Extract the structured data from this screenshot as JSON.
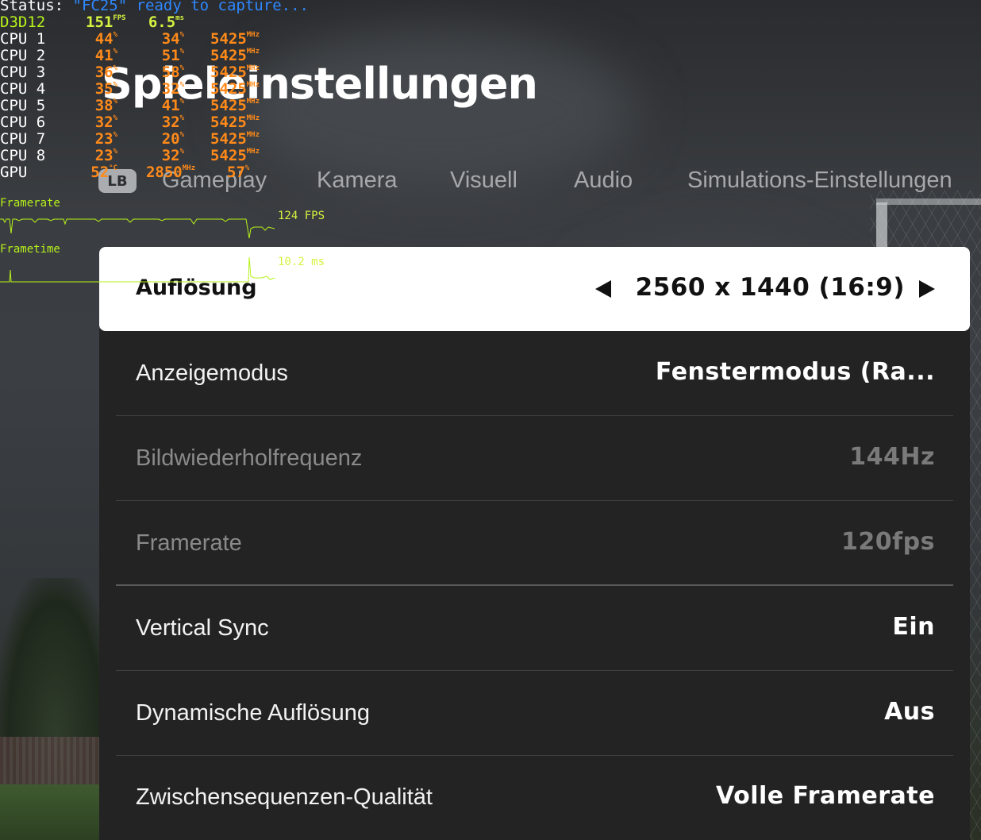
{
  "page": {
    "title": "Spieleinstellungen"
  },
  "tabs": {
    "lb_badge": "LB",
    "items": [
      "Gameplay",
      "Kamera",
      "Visuell",
      "Audio",
      "Simulations-Einstellungen"
    ]
  },
  "settings": [
    {
      "label": "Auflösung",
      "value": "2560 x 1440 (16:9)",
      "state": "selected"
    },
    {
      "label": "Anzeigemodus",
      "value": "Fenstermodus (Ra...",
      "state": "normal"
    },
    {
      "label": "Bildwiederholfrequenz",
      "value": "144Hz",
      "state": "disabled"
    },
    {
      "label": "Framerate",
      "value": "120fps",
      "state": "disabled"
    },
    {
      "label": "Vertical Sync",
      "value": "Ein",
      "state": "normal"
    },
    {
      "label": "Dynamische Auflösung",
      "value": "Aus",
      "state": "normal"
    },
    {
      "label": "Zwischensequenzen-Qualität",
      "value": "Volle Framerate",
      "state": "normal"
    }
  ],
  "osd": {
    "status_key": "Status:",
    "status_value": "\"FC25\" ready to capture...",
    "api": {
      "name": "D3D12",
      "fps": "151",
      "fps_unit": "FPS",
      "frametime": "6.5",
      "frametime_unit": "ms"
    },
    "cpus": [
      {
        "name": "CPU 1",
        "load": "44",
        "temp": "34",
        "clock": "5425"
      },
      {
        "name": "CPU 2",
        "load": "41",
        "temp": "51",
        "clock": "5425"
      },
      {
        "name": "CPU 3",
        "load": "36",
        "temp": "58",
        "clock": "5425"
      },
      {
        "name": "CPU 4",
        "load": "35",
        "temp": "32",
        "clock": "5425"
      },
      {
        "name": "CPU 5",
        "load": "38",
        "temp": "41",
        "clock": "5425"
      },
      {
        "name": "CPU 6",
        "load": "32",
        "temp": "32",
        "clock": "5425"
      },
      {
        "name": "CPU 7",
        "load": "23",
        "temp": "20",
        "clock": "5425"
      },
      {
        "name": "CPU 8",
        "load": "23",
        "temp": "32",
        "clock": "5425"
      }
    ],
    "percent_unit": "%",
    "clock_unit": "MHz",
    "gpu": {
      "name": "GPU",
      "temp": "52",
      "temp_unit": "°C",
      "clock": "2850",
      "clock_unit": "MHz",
      "load": "57",
      "load_unit": "%"
    },
    "framerate_label": "Framerate",
    "framerate_readout": "124 FPS",
    "frametime_label": "Frametime",
    "frametime_readout": "10.2 ms",
    "colors": {
      "accent": "#b7f21a",
      "values": "#ff8a1a",
      "status": "#2f88ff"
    }
  }
}
